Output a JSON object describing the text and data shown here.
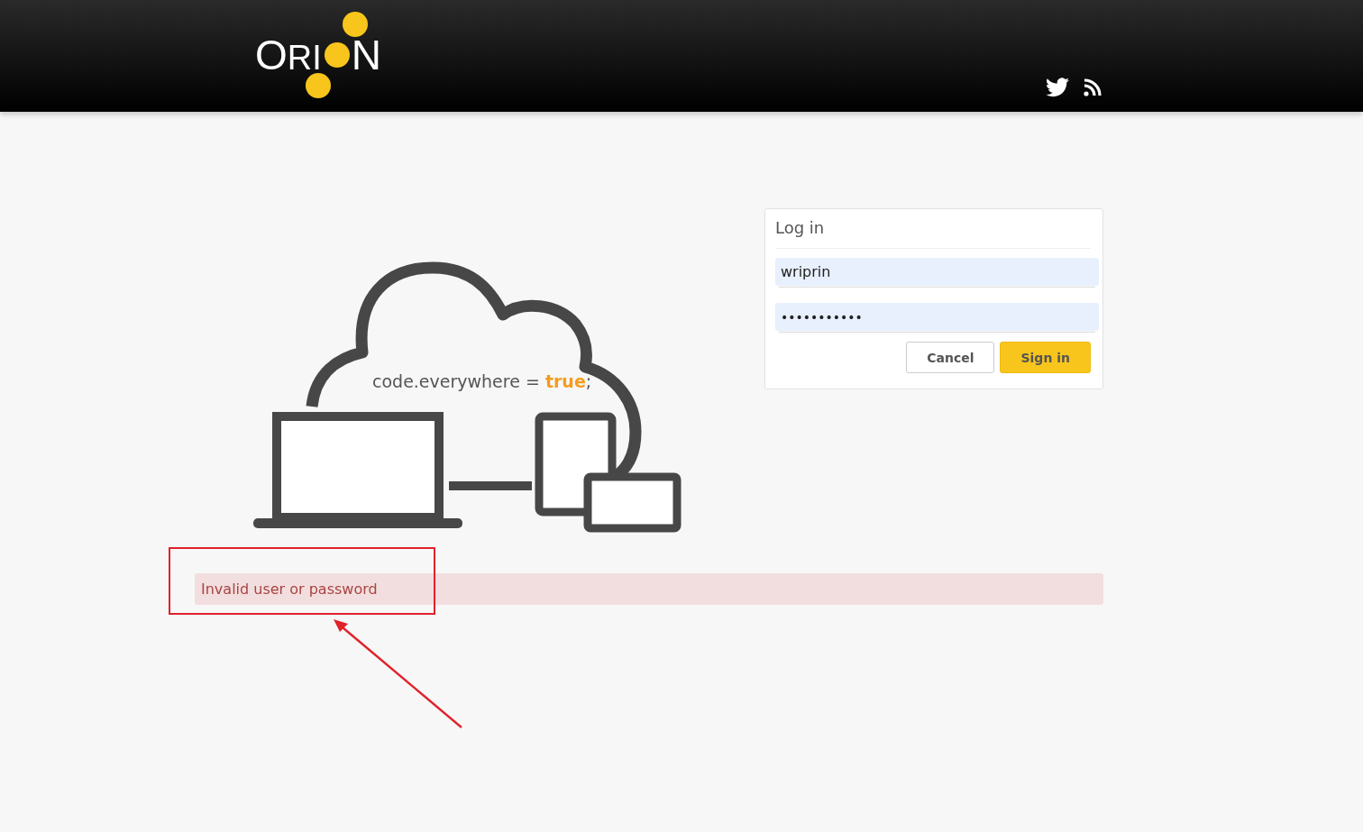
{
  "header": {
    "logo": {
      "left": "ORI",
      "right": "N"
    }
  },
  "illustration": {
    "code_parts": [
      {
        "text": "code.everywhere = ",
        "kind": "plain"
      },
      {
        "text": "true",
        "kind": "keyword"
      },
      {
        "text": ";",
        "kind": "plain"
      }
    ]
  },
  "login": {
    "title": "Log in",
    "fields": [
      {
        "kind": "text",
        "value": "wriprin"
      },
      {
        "kind": "password",
        "value": "•••••••••••"
      }
    ],
    "buttons": [
      {
        "label": "Cancel",
        "kind": "secondary"
      },
      {
        "label": "Sign in",
        "kind": "primary"
      }
    ]
  },
  "error": {
    "message": "Invalid user or password"
  }
}
